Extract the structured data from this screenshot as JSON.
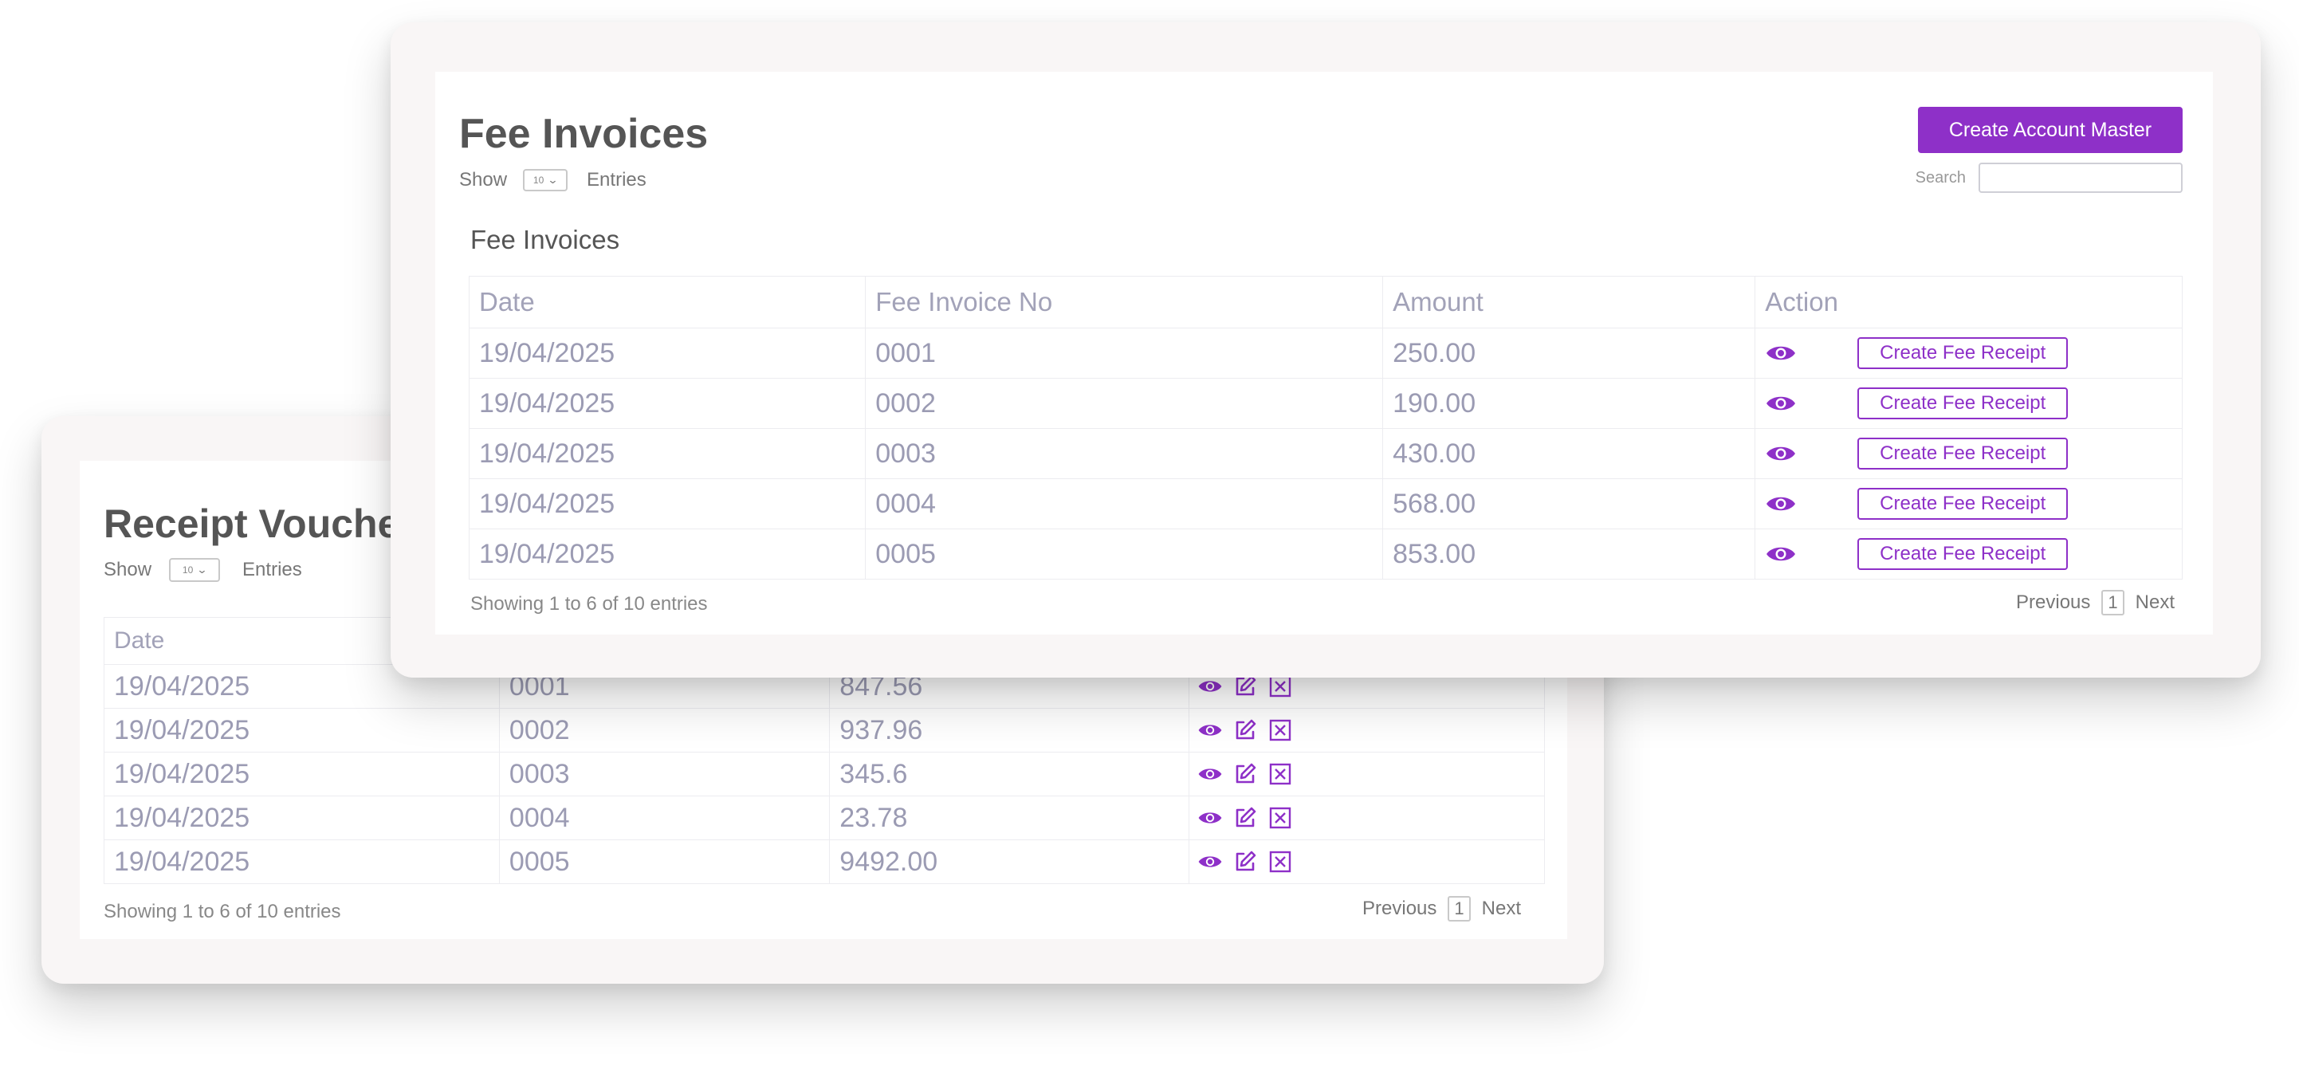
{
  "colors": {
    "accent": "#8e30c8",
    "text_muted": "#9b9bb3",
    "title": "#555555"
  },
  "receipt_voucher": {
    "title": "Receipt Voucher",
    "show_label": "Show",
    "entries_value": "10",
    "entries_label": "Entries",
    "columns": [
      "Date",
      "",
      "",
      ""
    ],
    "rows": [
      {
        "date": "19/04/2025",
        "no": "0001",
        "amount": "847.56"
      },
      {
        "date": "19/04/2025",
        "no": "0002",
        "amount": "937.96"
      },
      {
        "date": "19/04/2025",
        "no": "0003",
        "amount": "345.6"
      },
      {
        "date": "19/04/2025",
        "no": "0004",
        "amount": "23.78"
      },
      {
        "date": "19/04/2025",
        "no": "0005",
        "amount": "9492.00"
      }
    ],
    "row_icons": [
      "eye-icon",
      "edit-icon",
      "delete-icon"
    ],
    "footer_info": "Showing 1 to 6 of 10 entries",
    "pagination": {
      "previous": "Previous",
      "page": "1",
      "next": "Next"
    }
  },
  "fee_invoices": {
    "title": "Fee Invoices",
    "show_label": "Show",
    "entries_value": "10",
    "entries_label": "Entries",
    "create_button": "Create Account Master",
    "search_label": "Search",
    "search_value": "",
    "table_title": "Fee Invoices",
    "columns": [
      "Date",
      "Fee Invoice No",
      "Amount",
      "Action"
    ],
    "rows": [
      {
        "date": "19/04/2025",
        "no": "0001",
        "amount": "250.00",
        "action": "Create Fee Receipt"
      },
      {
        "date": "19/04/2025",
        "no": "0002",
        "amount": "190.00",
        "action": "Create Fee Receipt"
      },
      {
        "date": "19/04/2025",
        "no": "0003",
        "amount": "430.00",
        "action": "Create Fee Receipt"
      },
      {
        "date": "19/04/2025",
        "no": "0004",
        "amount": "568.00",
        "action": "Create Fee Receipt"
      },
      {
        "date": "19/04/2025",
        "no": "0005",
        "amount": "853.00",
        "action": "Create Fee Receipt"
      }
    ],
    "footer_info": "Showing 1 to 6 of 10 entries",
    "pagination": {
      "previous": "Previous",
      "page": "1",
      "next": "Next"
    }
  }
}
